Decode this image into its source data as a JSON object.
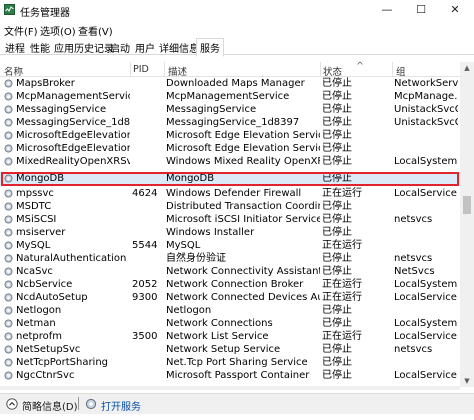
{
  "window": {
    "title": "任务管理器",
    "minimize": "—",
    "maximize": "☐",
    "close": "✕"
  },
  "menu": [
    "文件(F)",
    "选项(O)",
    "查看(V)"
  ],
  "tabs": [
    {
      "label": "进程",
      "active": false
    },
    {
      "label": "性能",
      "active": false
    },
    {
      "label": "应用历史记录",
      "active": false
    },
    {
      "label": "启动",
      "active": false
    },
    {
      "label": "用户",
      "active": false
    },
    {
      "label": "详细信息",
      "active": false
    },
    {
      "label": "服务",
      "active": true
    }
  ],
  "columns": {
    "name": "名称",
    "pid": "PID",
    "desc": "描述",
    "status": "状态",
    "group": "组",
    "sort_indicator": "^"
  },
  "rows": [
    {
      "name": "MapsBroker",
      "pid": "",
      "desc": "Downloaded Maps Manager",
      "status": "已停止",
      "group": "NetworkServ..."
    },
    {
      "name": "McpManagementService",
      "pid": "",
      "desc": "McpManagementService",
      "status": "已停止",
      "group": "McpManage..."
    },
    {
      "name": "MessagingService",
      "pid": "",
      "desc": "MessagingService",
      "status": "已停止",
      "group": "UnistackSvcG..."
    },
    {
      "name": "MessagingService_1d8397",
      "pid": "",
      "desc": "MessagingService_1d8397",
      "status": "已停止",
      "group": "UnistackSvcG..."
    },
    {
      "name": "MicrosoftEdgeElevations...",
      "pid": "",
      "desc": "Microsoft Edge Elevation Service ...",
      "status": "已停止",
      "group": ""
    },
    {
      "name": "MicrosoftEdgeElevations...",
      "pid": "",
      "desc": "Microsoft Edge Elevation Service ...",
      "status": "已停止",
      "group": ""
    },
    {
      "name": "MixedRealityOpenXRSvc",
      "pid": "",
      "desc": "Windows Mixed Reality OpenXR S...",
      "status": "已停止",
      "group": "LocalSystem..."
    },
    {
      "name": "MongoDB",
      "pid": "",
      "desc": "MongoDB",
      "status": "已停止",
      "group": "",
      "selected": true
    },
    {
      "name": "mpssvc",
      "pid": "4624",
      "desc": "Windows Defender Firewall",
      "status": "正在运行",
      "group": "LocalService..."
    },
    {
      "name": "MSDTC",
      "pid": "",
      "desc": "Distributed Transaction Coordinat...",
      "status": "已停止",
      "group": ""
    },
    {
      "name": "MSiSCSI",
      "pid": "",
      "desc": "Microsoft iSCSI Initiator Service",
      "status": "已停止",
      "group": "netsvcs"
    },
    {
      "name": "msiserver",
      "pid": "",
      "desc": "Windows Installer",
      "status": "已停止",
      "group": ""
    },
    {
      "name": "MySQL",
      "pid": "5544",
      "desc": "MySQL",
      "status": "正在运行",
      "group": ""
    },
    {
      "name": "NaturalAuthentication",
      "pid": "",
      "desc": "自然身份验证",
      "status": "已停止",
      "group": "netsvcs"
    },
    {
      "name": "NcaSvc",
      "pid": "",
      "desc": "Network Connectivity Assistant",
      "status": "已停止",
      "group": "NetSvcs"
    },
    {
      "name": "NcbService",
      "pid": "2052",
      "desc": "Network Connection Broker",
      "status": "正在运行",
      "group": "LocalSystem..."
    },
    {
      "name": "NcdAutoSetup",
      "pid": "9300",
      "desc": "Network Connected Devices Auto...",
      "status": "正在运行",
      "group": "LocalService..."
    },
    {
      "name": "Netlogon",
      "pid": "",
      "desc": "Netlogon",
      "status": "已停止",
      "group": ""
    },
    {
      "name": "Netman",
      "pid": "",
      "desc": "Network Connections",
      "status": "已停止",
      "group": "LocalSystem..."
    },
    {
      "name": "netprofm",
      "pid": "3500",
      "desc": "Network List Service",
      "status": "正在运行",
      "group": "LocalService..."
    },
    {
      "name": "NetSetupSvc",
      "pid": "",
      "desc": "Network Setup Service",
      "status": "已停止",
      "group": "netsvcs"
    },
    {
      "name": "NetTcpPortSharing",
      "pid": "",
      "desc": "Net.Tcp Port Sharing Service",
      "status": "已停止",
      "group": ""
    },
    {
      "name": "NgcCtnrSvc",
      "pid": "",
      "desc": "Microsoft Passport Container",
      "status": "已停止",
      "group": "LocalService..."
    }
  ],
  "status_bar": {
    "collapse_label": "简略信息(D)",
    "open_services_label": "打开服务"
  },
  "colors": {
    "selected_row": "#dceaf8",
    "highlight_border": "#e0232d",
    "link": "#0a4fa8"
  },
  "icons": [
    "task-manager-icon",
    "service-gear-icon",
    "collapse-arrow-icon",
    "services-app-icon"
  ]
}
